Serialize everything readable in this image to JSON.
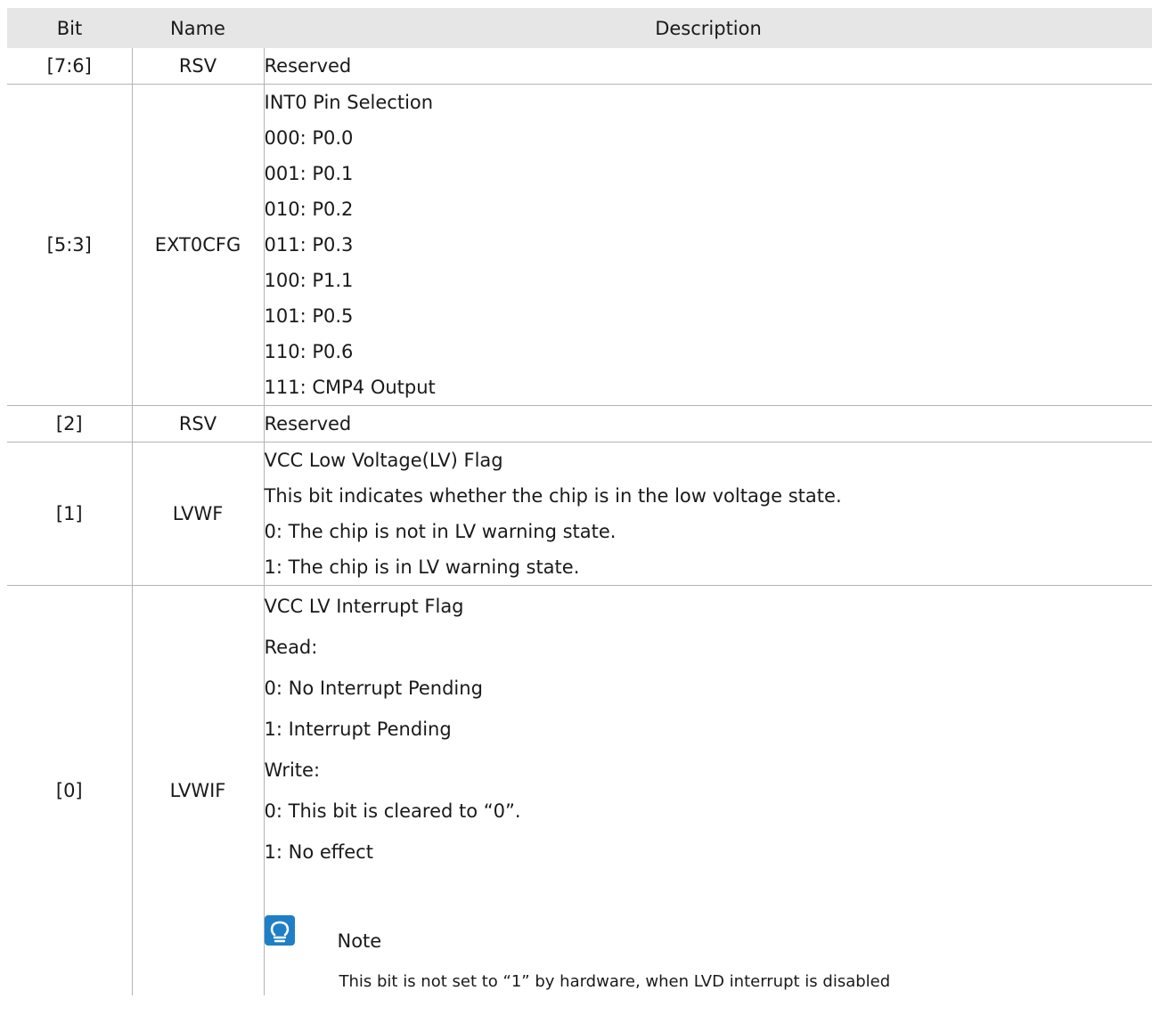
{
  "table": {
    "headers": {
      "bit": "Bit",
      "name": "Name",
      "description": "Description"
    },
    "rows": [
      {
        "bit": "[7:6]",
        "name": "RSV",
        "lines": [
          "Reserved"
        ]
      },
      {
        "bit": "[5:3]",
        "name": "EXT0CFG",
        "lines": [
          "INT0 Pin Selection",
          "000: P0.0",
          "001: P0.1",
          "010: P0.2",
          "011: P0.3",
          "100: P1.1",
          "101: P0.5",
          "110: P0.6",
          "111: CMP4 Output"
        ]
      },
      {
        "bit": "[2]",
        "name": "RSV",
        "lines": [
          "Reserved"
        ]
      },
      {
        "bit": "[1]",
        "name": "LVWF",
        "lines": [
          "VCC Low Voltage(LV) Flag",
          "This bit indicates whether the chip is in the low voltage state.",
          "0: The chip is not in LV warning state.",
          "1: The chip is in LV warning state."
        ]
      },
      {
        "bit": "[0]",
        "name": "LVWIF",
        "lines": [
          "VCC LV Interrupt Flag",
          "Read:",
          "0: No Interrupt Pending",
          "1: Interrupt Pending",
          "Write:",
          "0: This bit is cleared to “0”.",
          "1: No effect"
        ],
        "note": {
          "icon": "lightbulb-icon",
          "title": "Note",
          "text": "This bit is not set to “1” by hardware, when LVD interrupt is disabled"
        }
      }
    ]
  },
  "colors": {
    "header_bg": "#e6e6e6",
    "border": "#b4b4b4",
    "note_icon": "#1e7fc6"
  }
}
